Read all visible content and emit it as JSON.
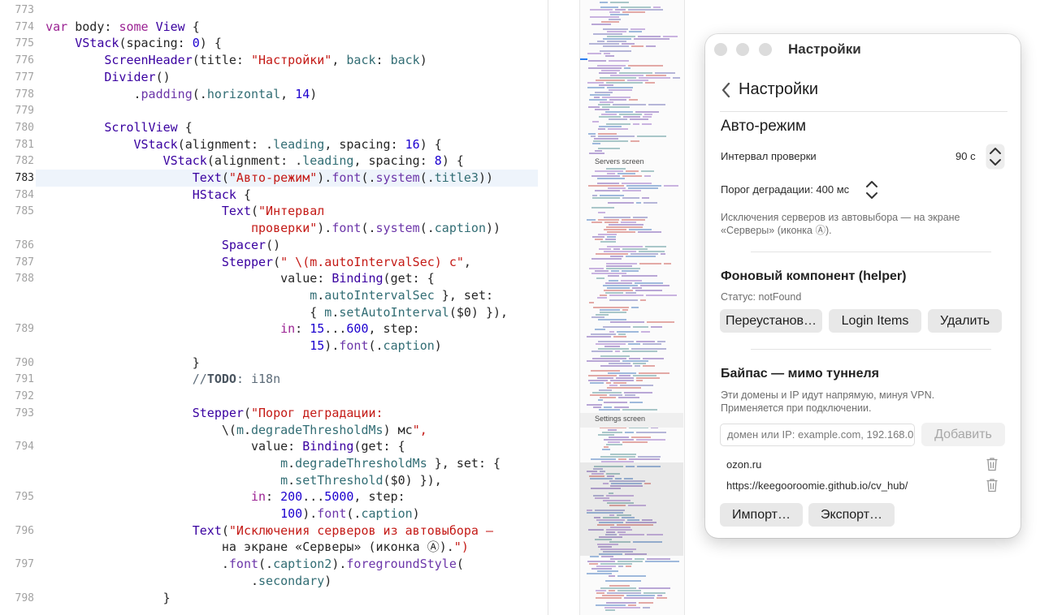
{
  "editor": {
    "current_line": "783",
    "lines": [
      {
        "n": "773",
        "t": ""
      },
      {
        "n": "774",
        "t": "    var body: some View {"
      },
      {
        "n": "775",
        "t": "        VStack(spacing: 0) {"
      },
      {
        "n": "776",
        "t": "            ScreenHeader(title: \"Настройки\", back: back)"
      },
      {
        "n": "777",
        "t": "            Divider()"
      },
      {
        "n": "778",
        "t": "                .padding(.horizontal, 14)"
      },
      {
        "n": "779",
        "t": ""
      },
      {
        "n": "780",
        "t": "            ScrollView {"
      },
      {
        "n": "781",
        "t": "                VStack(alignment: .leading, spacing: 16) {"
      },
      {
        "n": "782",
        "t": "                    VStack(alignment: .leading, spacing: 8) {"
      },
      {
        "n": "783",
        "t": "                        Text(\"Авто-режим\").font(.system(.title3))"
      },
      {
        "n": "784",
        "t": "                        HStack {"
      },
      {
        "n": "785",
        "t": "                            Text(\"Интервал"
      },
      {
        "n": "",
        "t": "                                проверки\").font(.system(.caption))"
      },
      {
        "n": "786",
        "t": "                            Spacer()"
      },
      {
        "n": "787",
        "t": "                            Stepper(\" \\(m.autoIntervalSec) с\","
      },
      {
        "n": "788",
        "t": "                                    value: Binding(get: {"
      },
      {
        "n": "",
        "t": "                                        m.autoIntervalSec }, set:"
      },
      {
        "n": "",
        "t": "                                        { m.setAutoInterval($0) }),"
      },
      {
        "n": "789",
        "t": "                                    in: 15...600, step:"
      },
      {
        "n": "",
        "t": "                                        15).font(.caption)"
      },
      {
        "n": "790",
        "t": "                        }"
      },
      {
        "n": "791",
        "t": "                        //TODO: i18n"
      },
      {
        "n": "792",
        "t": ""
      },
      {
        "n": "793",
        "t": "                        Stepper(\"Порог деградации:"
      },
      {
        "n": "",
        "t": "                            \\(m.degradeThresholdMs) мс\","
      },
      {
        "n": "794",
        "t": "                                value: Binding(get: {"
      },
      {
        "n": "",
        "t": "                                    m.degradeThresholdMs }, set: {"
      },
      {
        "n": "",
        "t": "                                    m.setThreshold($0) }),"
      },
      {
        "n": "795",
        "t": "                                in: 200...5000, step:"
      },
      {
        "n": "",
        "t": "                                    100).font(.caption)"
      },
      {
        "n": "796",
        "t": "                        Text(\"Исключения серверов из автовыбора —"
      },
      {
        "n": "",
        "t": "                            на экране «Серверы» (иконка Ⓐ).\")"
      },
      {
        "n": "797",
        "t": "                            .font(.caption2).foregroundStyle("
      },
      {
        "n": "",
        "t": "                                .secondary)"
      },
      {
        "n": "798",
        "t": "                    }"
      }
    ]
  },
  "minimap": {
    "sections": [
      "Servers screen",
      "Settings screen"
    ]
  },
  "window": {
    "title": "Настройки",
    "nav_title": "Настройки",
    "auto": {
      "heading": "Авто-режим",
      "interval_label": "Интервал проверки",
      "interval_value": "90 с",
      "threshold_label": "Порог деградации: 400 мс",
      "note_line1": "Исключения серверов из автовыбора — на экране",
      "note_line2": "«Серверы» (иконка Ⓐ)."
    },
    "helper": {
      "heading": "Фоновый компонент (helper)",
      "status": "Статус: notFound",
      "buttons": [
        "Переустанов…",
        "Login Items",
        "Удалить"
      ]
    },
    "bypass": {
      "heading": "Байпас — мимо туннеля",
      "desc_line1": "Эти домены и IP идут напрямую, минуя VPN.",
      "desc_line2": "Применяется при подключении.",
      "input_placeholder": "домен или IP: example.com, 192.168.0",
      "add_label": "Добавить",
      "entries": [
        "ozon.ru",
        "https://keegooroomie.github.io/cv_hub/"
      ],
      "import_label": "Импорт…",
      "export_label": "Экспорт…"
    }
  },
  "colors": {
    "keyword": "#9b2393",
    "type": "#3900a0",
    "function": "#6c36a9",
    "member": "#326d74",
    "string": "#c41a16",
    "number": "#1c00cf",
    "current_line": "#eef4fb"
  }
}
